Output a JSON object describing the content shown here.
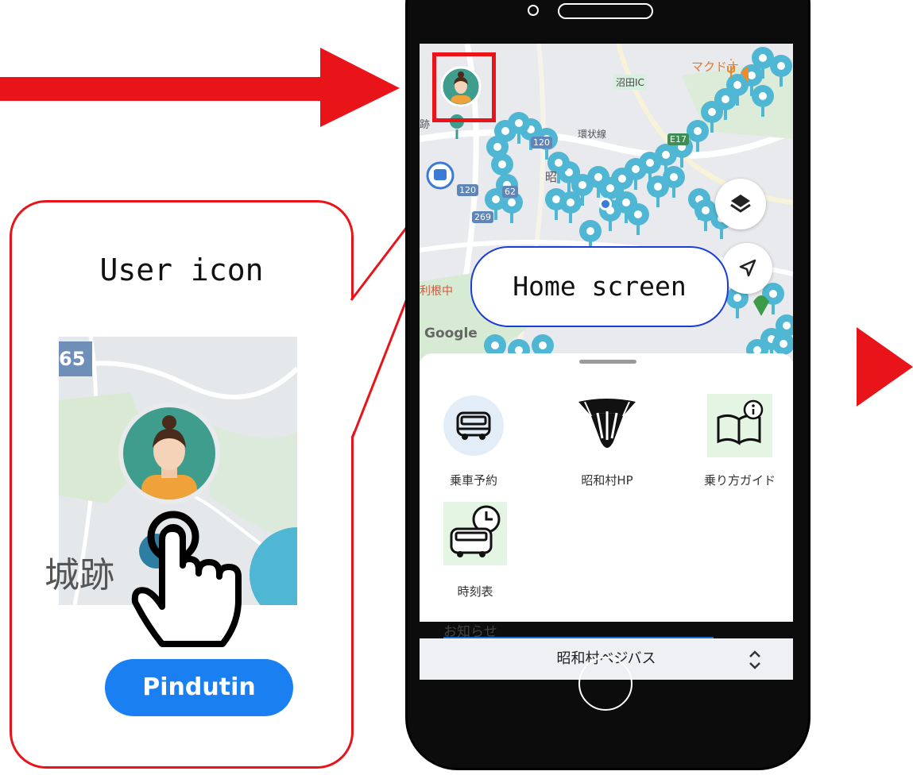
{
  "callout": {
    "title": "User icon",
    "map_label": "城跡",
    "map_badge": "65",
    "button_label": "Pindutin"
  },
  "phone": {
    "map": {
      "labels": {
        "numata_ic": "沼田IC",
        "mcdonalds": "マクドナ",
        "kanjosen": "環状線",
        "road120a": "120",
        "road120b": "120",
        "road62": "62",
        "road269": "269",
        "e17": "E17",
        "tonechu": "利根中",
        "showa": "昭",
        "seki": "跡",
        "google": "Google"
      }
    },
    "callout_home": "Home screen",
    "grid": [
      {
        "label": "乗車予約"
      },
      {
        "label": "昭和村HP"
      },
      {
        "label": "乗り方ガイド"
      },
      {
        "label": "時刻表"
      }
    ],
    "notice_title": "お知らせ",
    "bottom_title": "昭和村ベジバス"
  },
  "colors": {
    "accent_red": "#e8141a",
    "pin_blue": "#4fb6d3",
    "pill_blue": "#1a7ff0",
    "home_border": "#1a3dd6"
  }
}
